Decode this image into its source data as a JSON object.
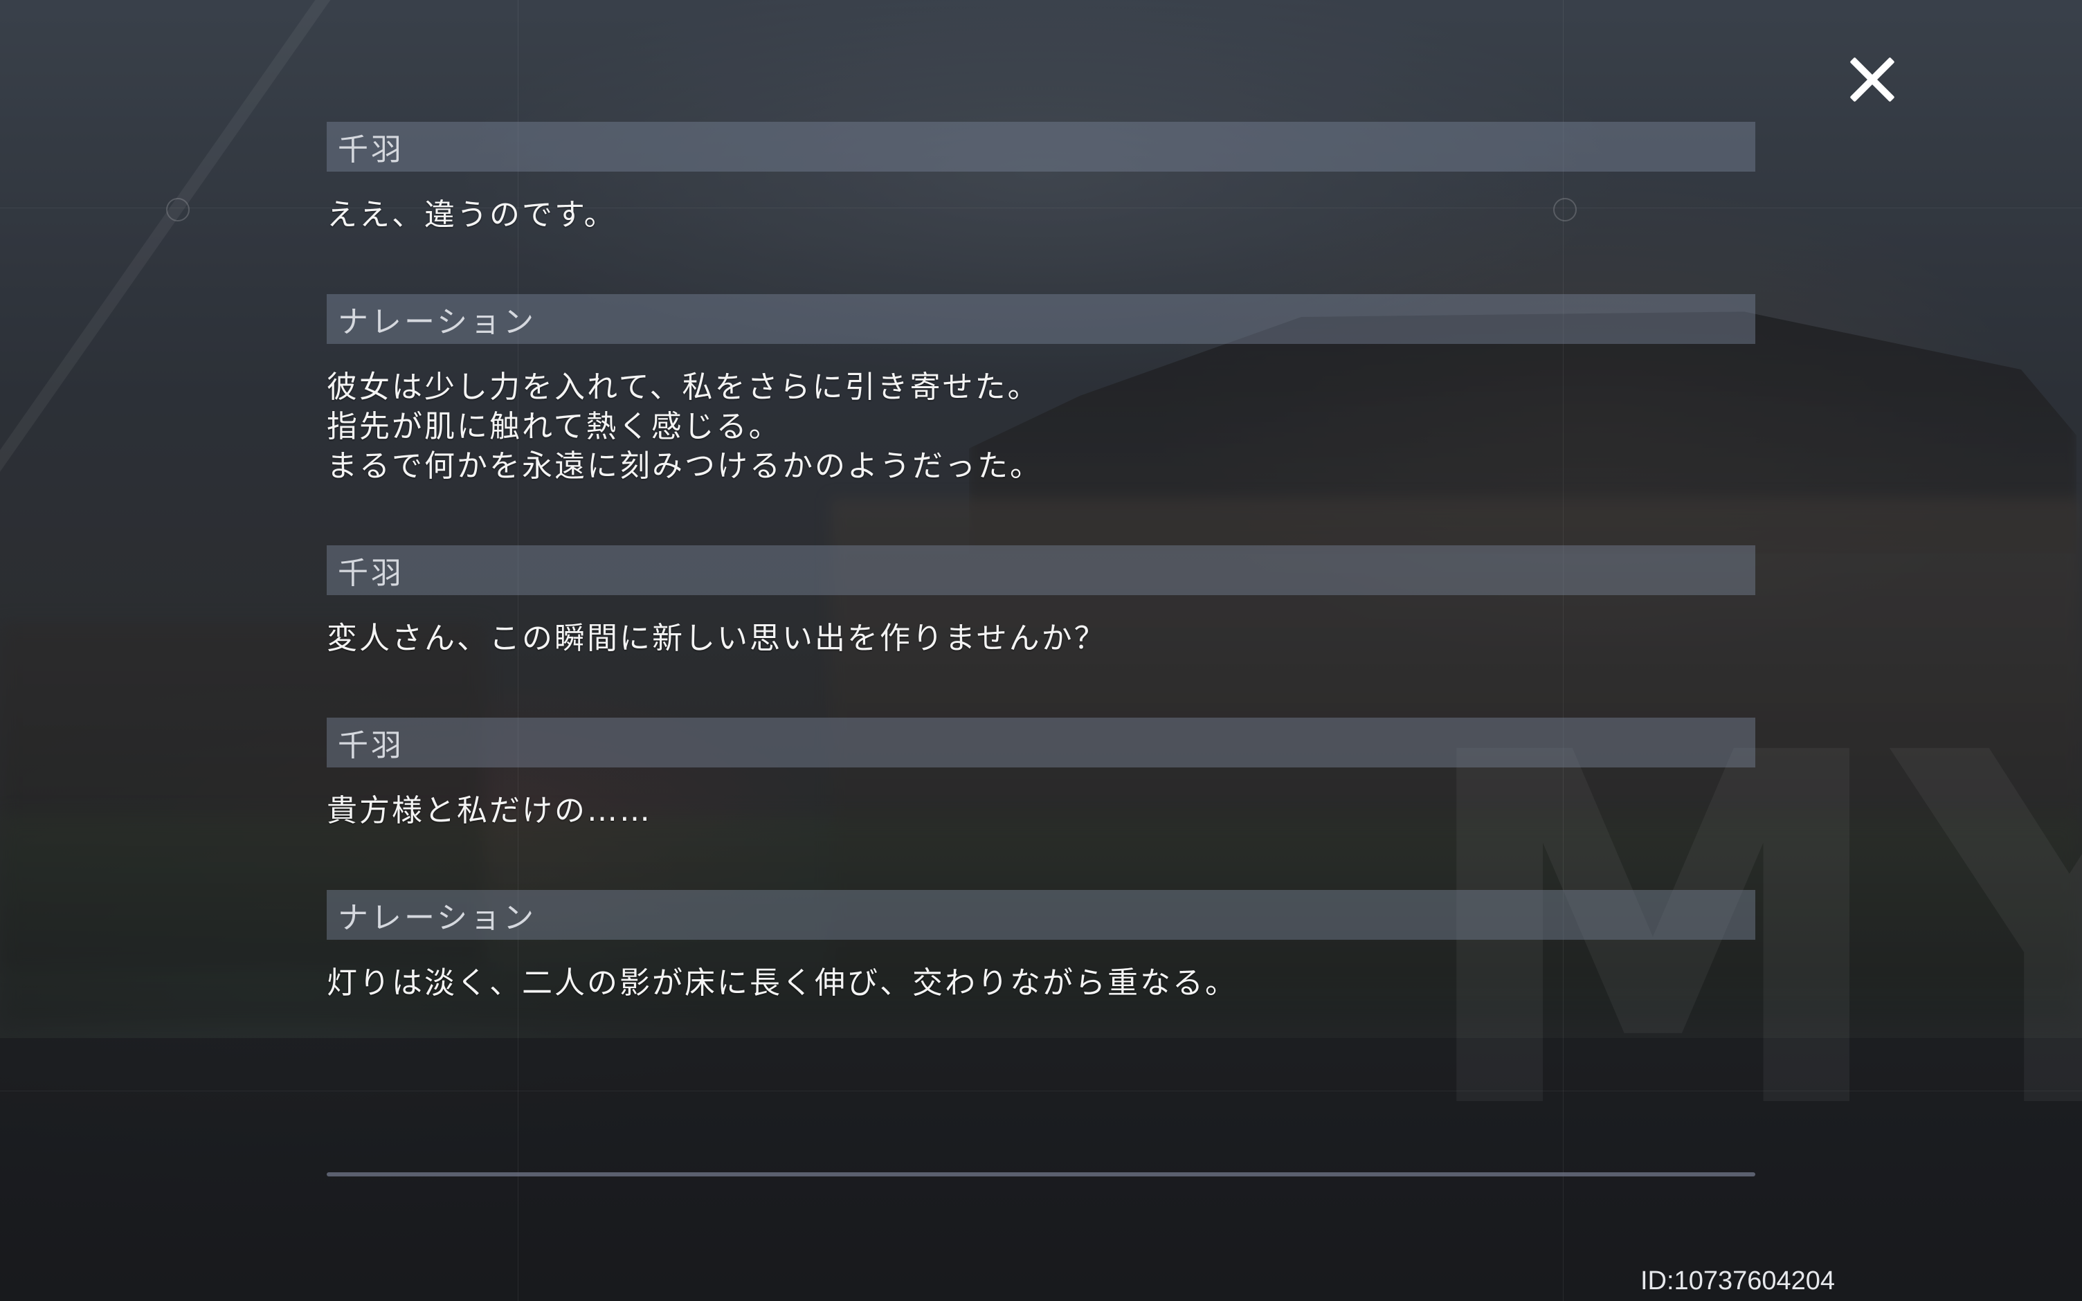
{
  "entries": [
    {
      "speaker": "千羽",
      "lines": [
        "ええ、違うのです。"
      ]
    },
    {
      "speaker": "ナレーション",
      "lines": [
        "彼女は少し力を入れて、私をさらに引き寄せた。",
        "指先が肌に触れて熱く感じる。",
        "まるで何かを永遠に刻みつけるかのようだった。"
      ]
    },
    {
      "speaker": "千羽",
      "lines": [
        "変人さん、この瞬間に新しい思い出を作りませんか？"
      ]
    },
    {
      "speaker": "千羽",
      "lines": [
        "貴方様と私だけの……"
      ]
    },
    {
      "speaker": "ナレーション",
      "lines": [
        "灯りは淡く、二人の影が床に長く伸び、交わりながら重なる。"
      ]
    }
  ],
  "id_text": "ID:10737604204",
  "close_icon": "close-icon",
  "colors": {
    "speaker_bar": "#6f7a8c",
    "text": "#f4f4f4",
    "divider": "#787d91"
  }
}
